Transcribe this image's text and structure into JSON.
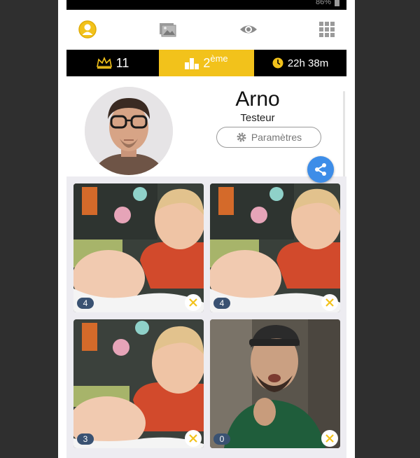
{
  "status_bar": {
    "battery_text": "86%"
  },
  "nav": {
    "tabs": [
      {
        "icon": "profile-icon",
        "active": true
      },
      {
        "icon": "gallery-icon"
      },
      {
        "icon": "eye-icon"
      },
      {
        "icon": "grid-menu-icon"
      }
    ]
  },
  "stats": {
    "crowns": "11",
    "rank_number": "2",
    "rank_suffix": "ème",
    "timer": "22h 38m"
  },
  "profile": {
    "name": "Arno",
    "role": "Testeur",
    "settings_label": "Paramètres"
  },
  "photos": [
    {
      "count": "4"
    },
    {
      "count": "4"
    },
    {
      "count": "3"
    },
    {
      "count": "0"
    }
  ],
  "colors": {
    "accent_yellow": "#f2c21b",
    "share_blue": "#3d8de8",
    "badge_blue": "#3a5272",
    "grid_bg": "#edecf1"
  }
}
